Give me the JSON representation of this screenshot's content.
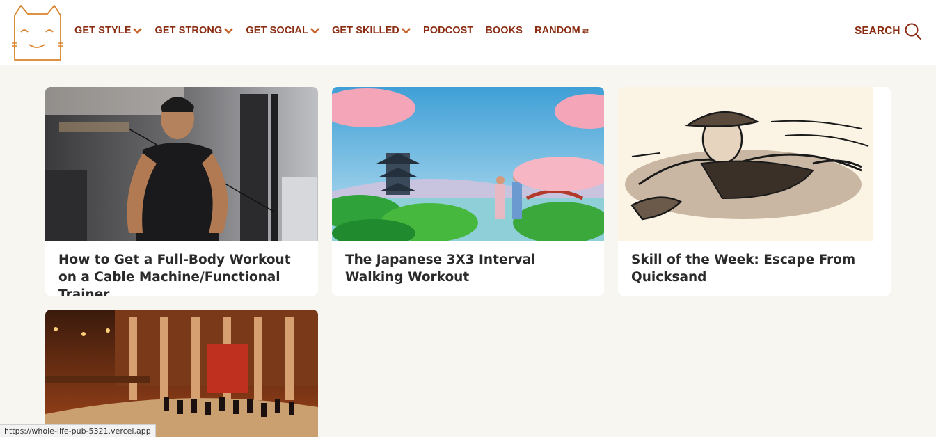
{
  "nav": {
    "items": [
      {
        "label": "GET STYLE",
        "dropdown": true
      },
      {
        "label": "GET STRONG",
        "dropdown": true
      },
      {
        "label": "GET SOCIAL",
        "dropdown": true
      },
      {
        "label": "GET SKILLED",
        "dropdown": true
      },
      {
        "label": "PODCOST",
        "dropdown": false
      },
      {
        "label": "BOOKS",
        "dropdown": false
      },
      {
        "label": "RANDOM",
        "dropdown": false
      }
    ],
    "search_label": "SEARCH"
  },
  "articles": [
    {
      "title": "How to Get a Full-Body Workout on a Cable Machine/Functional Trainer",
      "image": "man-on-cable-machine"
    },
    {
      "title": "The Japanese 3X3 Interval Walking Workout",
      "image": "couple-walking-japanese-garden"
    },
    {
      "title": "Skill of the Week: Escape From Quicksand",
      "image": "man-sinking-in-quicksand"
    },
    {
      "title": "",
      "image": "orchestra-concert-hall"
    }
  ],
  "status": {
    "url": "https://whole-life-pub-5321.vercel.app"
  },
  "colors": {
    "accent": "#8a2c12",
    "underline": "#c9652c",
    "logo": "#d9822b",
    "background": "#f7f6f0"
  }
}
